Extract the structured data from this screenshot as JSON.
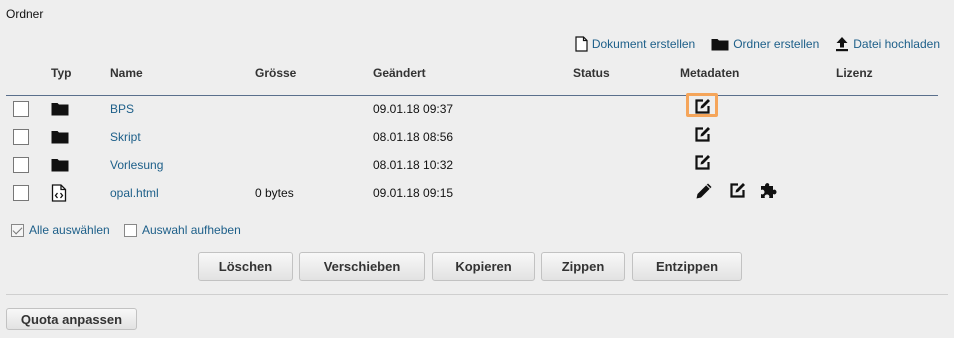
{
  "page": {
    "title": "Ordner"
  },
  "toolbar": {
    "create_document": "Dokument erstellen",
    "create_folder": "Ordner erstellen",
    "upload_file": "Datei hochladen"
  },
  "table": {
    "headers": {
      "type": "Typ",
      "name": "Name",
      "size": "Grösse",
      "modified": "Geändert",
      "status": "Status",
      "metadata": "Metadaten",
      "license": "Lizenz"
    },
    "rows": [
      {
        "type_icon": "folder-icon",
        "name": "BPS",
        "size": "",
        "modified": "09.01.18 09:37"
      },
      {
        "type_icon": "folder-icon",
        "name": "Skript",
        "size": "",
        "modified": "08.01.18 08:56"
      },
      {
        "type_icon": "folder-icon",
        "name": "Vorlesung",
        "size": "",
        "modified": "08.01.18 10:32"
      },
      {
        "type_icon": "html-file-icon",
        "name": "opal.html",
        "size": "0 bytes",
        "modified": "09.01.18 09:15"
      }
    ]
  },
  "selection": {
    "select_all": "Alle auswählen",
    "deselect": "Auswahl aufheben"
  },
  "actions": {
    "delete": "Löschen",
    "move": "Verschieben",
    "copy": "Kopieren",
    "zip": "Zippen",
    "unzip": "Entzippen"
  },
  "quota": {
    "label": "Quota anpassen"
  },
  "colors": {
    "link": "#1d5f89",
    "highlight": "#f5a55a",
    "header_line": "#5a6f8c"
  }
}
